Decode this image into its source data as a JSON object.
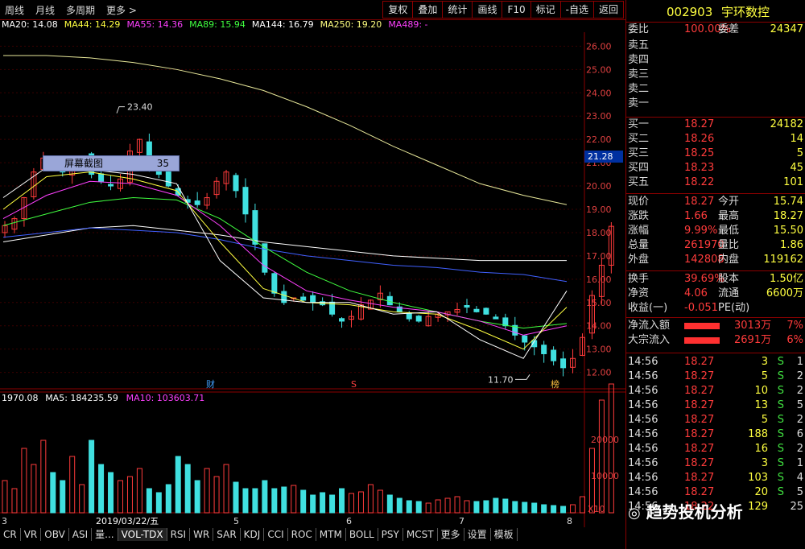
{
  "toolbar": {
    "left": [
      "周线",
      "月线",
      "多周期",
      "更多 >"
    ],
    "right": [
      "复权",
      "叠加",
      "统计",
      "画线",
      "F10",
      "标记",
      "-自选",
      "返回"
    ]
  },
  "ma_legend": [
    {
      "label": "MA20: 14.08",
      "color": "#ffffff"
    },
    {
      "label": "MA44: 14.29",
      "color": "#ffff40"
    },
    {
      "label": "MA55: 14.36",
      "color": "#ff40ff"
    },
    {
      "label": "MA89: 15.94",
      "color": "#40ff40"
    },
    {
      "label": "MA144: 16.79",
      "color": "#ffffff"
    },
    {
      "label": "MA250: 19.20",
      "color": "#ffff80"
    },
    {
      "label": "MA489: -",
      "color": "#ff40ff"
    }
  ],
  "price_axis": [
    "26.00",
    "25.00",
    "24.00",
    "23.00",
    "22.00",
    "21.00",
    "20.00",
    "19.00",
    "18.00",
    "17.00",
    "16.00",
    "15.00",
    "14.00",
    "13.00",
    "12.00"
  ],
  "current_price_tag": "21.28",
  "annotations": {
    "high": "23.40",
    "low": "11.70",
    "fin": "财",
    "s": "S",
    "rank": "榜"
  },
  "volume_legend": [
    "1970.08",
    "MA5: 184235.59",
    "MA10: 103603.71"
  ],
  "volume_axis": [
    "20000",
    "10000",
    "X10"
  ],
  "x_labels": [
    "3",
    "2019/03/22/五",
    "5",
    "6",
    "7",
    "8"
  ],
  "screenshot_tip": {
    "label": "屏幕截图",
    "value": "35"
  },
  "bottom_tabs": [
    "CR",
    "VR",
    "OBV",
    "ASI",
    "量...",
    "VOL-TDX",
    "RSI",
    "WR",
    "SAR",
    "KDJ",
    "CCI",
    "ROC",
    "MTM",
    "BOLL",
    "PSY",
    "MCST",
    "更多",
    "设置",
    "模板"
  ],
  "right_panel": {
    "code": "002903",
    "name": "宇环数控",
    "weibi": {
      "label": "委比",
      "value": "100.00%",
      "label2": "委差",
      "value2": "24347"
    },
    "sells": [
      {
        "label": "卖五",
        "price": "",
        "vol": ""
      },
      {
        "label": "卖四",
        "price": "",
        "vol": ""
      },
      {
        "label": "卖三",
        "price": "",
        "vol": ""
      },
      {
        "label": "卖二",
        "price": "",
        "vol": ""
      },
      {
        "label": "卖一",
        "price": "",
        "vol": ""
      }
    ],
    "buys": [
      {
        "label": "买一",
        "price": "18.27",
        "vol": "24182"
      },
      {
        "label": "买二",
        "price": "18.26",
        "vol": "14"
      },
      {
        "label": "买三",
        "price": "18.25",
        "vol": "5"
      },
      {
        "label": "买四",
        "price": "18.23",
        "vol": "45"
      },
      {
        "label": "买五",
        "price": "18.22",
        "vol": "101"
      }
    ],
    "quote": [
      {
        "l1": "现价",
        "v1": "18.27",
        "l2": "今开",
        "v2": "15.74"
      },
      {
        "l1": "涨跌",
        "v1": "1.66",
        "l2": "最高",
        "v2": "18.27"
      },
      {
        "l1": "涨幅",
        "v1": "9.99%",
        "l2": "最低",
        "v2": "15.50"
      },
      {
        "l1": "总量",
        "v1": "261970",
        "l2": "量比",
        "v2": "1.86"
      },
      {
        "l1": "外盘",
        "v1": "142808",
        "l2": "内盘",
        "v2": "119162"
      }
    ],
    "quote2": [
      {
        "l1": "换手",
        "v1": "39.69%",
        "l2": "股本",
        "v2": "1.50亿"
      },
      {
        "l1": "净资",
        "v1": "4.06",
        "l2": "流通",
        "v2": "6600万"
      },
      {
        "l1": "收益(一)",
        "v1": "-0.051",
        "l2": "PE(动)",
        "v2": ""
      }
    ],
    "flows": [
      {
        "label": "净流入额",
        "value": "3013万",
        "pct": "7%"
      },
      {
        "label": "大宗流入",
        "value": "2691万",
        "pct": "6%"
      }
    ],
    "ticks": [
      {
        "time": "14:56",
        "price": "18.27",
        "vol": "3",
        "side": "S",
        "n": "1"
      },
      {
        "time": "14:56",
        "price": "18.27",
        "vol": "5",
        "side": "S",
        "n": "2"
      },
      {
        "time": "14:56",
        "price": "18.27",
        "vol": "10",
        "side": "S",
        "n": "2"
      },
      {
        "time": "14:56",
        "price": "18.27",
        "vol": "13",
        "side": "S",
        "n": "5"
      },
      {
        "time": "14:56",
        "price": "18.27",
        "vol": "5",
        "side": "S",
        "n": "2"
      },
      {
        "time": "14:56",
        "price": "18.27",
        "vol": "188",
        "side": "S",
        "n": "6"
      },
      {
        "time": "14:56",
        "price": "18.27",
        "vol": "16",
        "side": "S",
        "n": "2"
      },
      {
        "time": "14:56",
        "price": "18.27",
        "vol": "3",
        "side": "S",
        "n": "1"
      },
      {
        "time": "14:56",
        "price": "18.27",
        "vol": "103",
        "side": "S",
        "n": "4"
      },
      {
        "time": "14:56",
        "price": "18.27",
        "vol": "20",
        "side": "S",
        "n": "5"
      },
      {
        "time": "14:56",
        "price": "18.22",
        "vol": "129",
        "side": "",
        "n": "25"
      }
    ]
  },
  "watermark": "趋势投机分析",
  "colors": {
    "up": "#ff3b3b",
    "down": "#40e0e0",
    "grid": "#8b0000"
  }
}
